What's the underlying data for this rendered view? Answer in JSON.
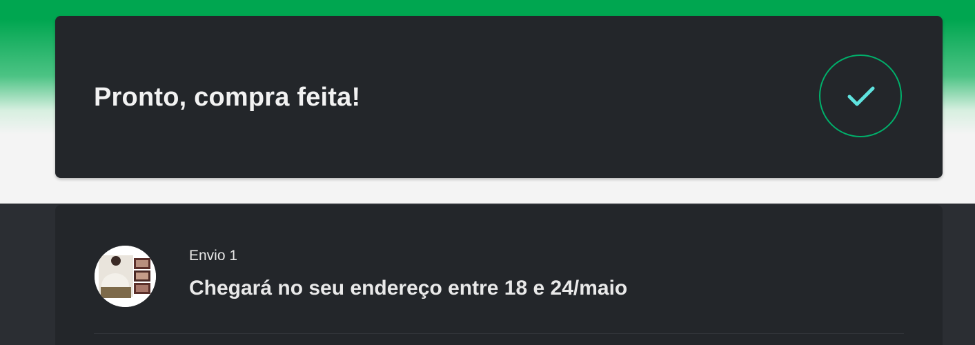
{
  "success": {
    "title": "Pronto, compra feita!",
    "icon": "check-icon",
    "accent_color": "#00b06b",
    "check_color": "#5fe3df"
  },
  "shipment": {
    "label": "Envio 1",
    "eta": "Chegará no seu endereço entre 18 e 24/maio",
    "thumbnail_icon": "product-thumbnail"
  },
  "colors": {
    "brand_green": "#00a650",
    "card_bg": "#23262a",
    "page_dark_bg": "#2b2e33"
  }
}
